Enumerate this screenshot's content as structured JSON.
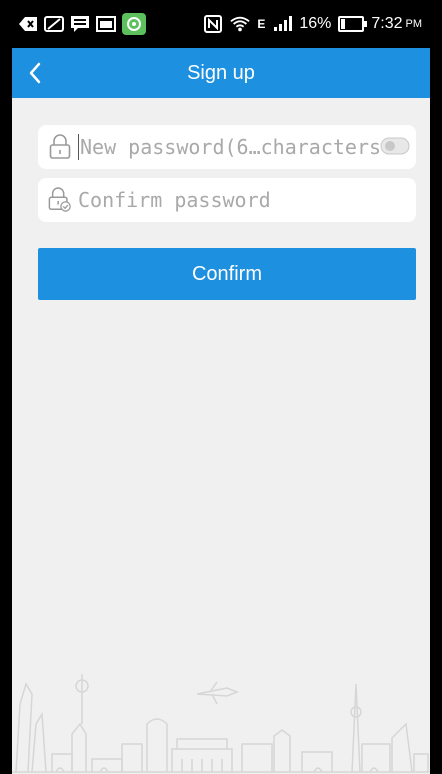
{
  "status_bar": {
    "battery": "16%",
    "battery_level": 0.16,
    "time": "7:32",
    "ampm": "PM",
    "signal_label": "E"
  },
  "header": {
    "title": "Sign up"
  },
  "form": {
    "new_password_placeholder": "New password(6…characters)",
    "confirm_password_placeholder": "Confirm password",
    "confirm_label": "Confirm"
  },
  "colors": {
    "accent": "#1e90e0",
    "background": "#f0f0f0"
  },
  "icons": [
    "back-chevron-icon",
    "lock-icon",
    "lock-check-icon",
    "eye-toggle-icon",
    "city-skyline-illustration"
  ]
}
